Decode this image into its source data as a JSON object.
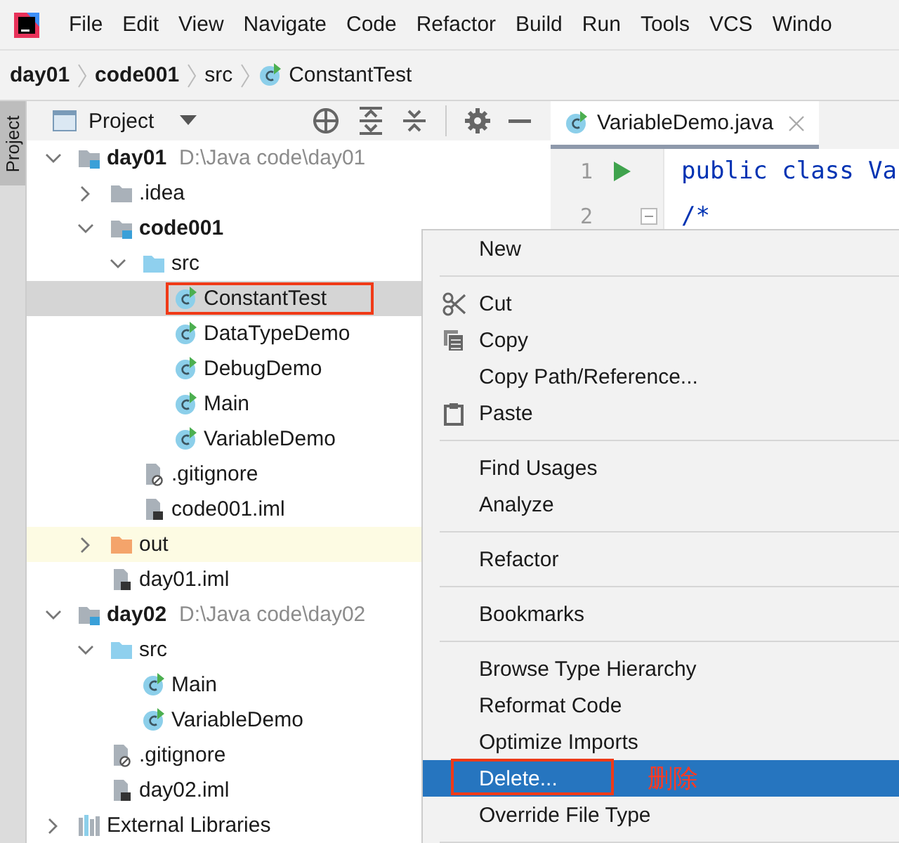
{
  "menu_bar": [
    "File",
    "Edit",
    "View",
    "Navigate",
    "Code",
    "Refactor",
    "Build",
    "Run",
    "Tools",
    "VCS",
    "Windo"
  ],
  "breadcrumbs": [
    {
      "label": "day01",
      "kind": "module"
    },
    {
      "label": "code001",
      "kind": "module"
    },
    {
      "label": "src",
      "kind": "folder"
    },
    {
      "label": "ConstantTest",
      "kind": "class"
    }
  ],
  "side_tab": {
    "label": "Project",
    "selected": true
  },
  "project_panel": {
    "title": "Project"
  },
  "tree": [
    {
      "label": "day01",
      "path": "D:\\Java code\\day01",
      "kind": "module",
      "expanded": true,
      "selected": false,
      "children": [
        {
          "label": ".idea",
          "kind": "folder",
          "expanded": false,
          "selected": false
        },
        {
          "label": "code001",
          "kind": "module",
          "expanded": true,
          "selected": false,
          "children": [
            {
              "label": "src",
              "kind": "source",
              "expanded": true,
              "selected": false,
              "children": [
                {
                  "label": "ConstantTest",
                  "kind": "class",
                  "selected": true,
                  "annotated": true
                },
                {
                  "label": "DataTypeDemo",
                  "kind": "class",
                  "selected": false
                },
                {
                  "label": "DebugDemo",
                  "kind": "class",
                  "selected": false
                },
                {
                  "label": "Main",
                  "kind": "class",
                  "selected": false
                },
                {
                  "label": "VariableDemo",
                  "kind": "class",
                  "selected": false
                }
              ]
            },
            {
              "label": ".gitignore",
              "kind": "ignore",
              "selected": false
            },
            {
              "label": "code001.iml",
              "kind": "iml",
              "selected": false
            }
          ]
        },
        {
          "label": "out",
          "kind": "excluded",
          "expanded": false,
          "selected": false
        },
        {
          "label": "day01.iml",
          "kind": "iml",
          "selected": false
        }
      ]
    },
    {
      "label": "day02",
      "path": "D:\\Java code\\day02",
      "kind": "module",
      "expanded": true,
      "selected": false,
      "children": [
        {
          "label": "src",
          "kind": "source",
          "expanded": true,
          "selected": false,
          "children": [
            {
              "label": "Main",
              "kind": "class",
              "selected": false
            },
            {
              "label": "VariableDemo",
              "kind": "class",
              "selected": false
            }
          ]
        },
        {
          "label": ".gitignore",
          "kind": "ignore",
          "selected": false
        },
        {
          "label": "day02.iml",
          "kind": "iml",
          "selected": false
        }
      ]
    },
    {
      "label": "External Libraries",
      "kind": "library",
      "expanded": false,
      "selected": false
    }
  ],
  "editor": {
    "tab": {
      "label": "VariableDemo.java",
      "selected": true
    },
    "lines": [
      {
        "number": "1",
        "code": "public class Va",
        "run": true
      },
      {
        "number": "2",
        "code": "/*",
        "run": false
      }
    ]
  },
  "context_menu": [
    {
      "kind": "item",
      "label": "New",
      "selected": false
    },
    {
      "kind": "separator"
    },
    {
      "kind": "cut",
      "label": "Cut",
      "selected": false
    },
    {
      "kind": "copy",
      "label": "Copy",
      "selected": false
    },
    {
      "kind": "item",
      "label": "Copy Path/Reference...",
      "selected": false
    },
    {
      "kind": "paste",
      "label": "Paste",
      "selected": false
    },
    {
      "kind": "separator"
    },
    {
      "kind": "item",
      "label": "Find Usages",
      "selected": false
    },
    {
      "kind": "item",
      "label": "Analyze",
      "selected": false
    },
    {
      "kind": "separator"
    },
    {
      "kind": "item",
      "label": "Refactor",
      "selected": false
    },
    {
      "kind": "separator"
    },
    {
      "kind": "item",
      "label": "Bookmarks",
      "selected": false
    },
    {
      "kind": "separator"
    },
    {
      "kind": "item",
      "label": "Browse Type Hierarchy",
      "selected": false
    },
    {
      "kind": "item",
      "label": "Reformat Code",
      "selected": false
    },
    {
      "kind": "item",
      "label": "Optimize Imports",
      "selected": false
    },
    {
      "kind": "item",
      "label": "Delete...",
      "selected": true,
      "annotated": true,
      "note": "删除"
    },
    {
      "kind": "item",
      "label": "Override File Type",
      "selected": false
    },
    {
      "kind": "separator"
    }
  ]
}
